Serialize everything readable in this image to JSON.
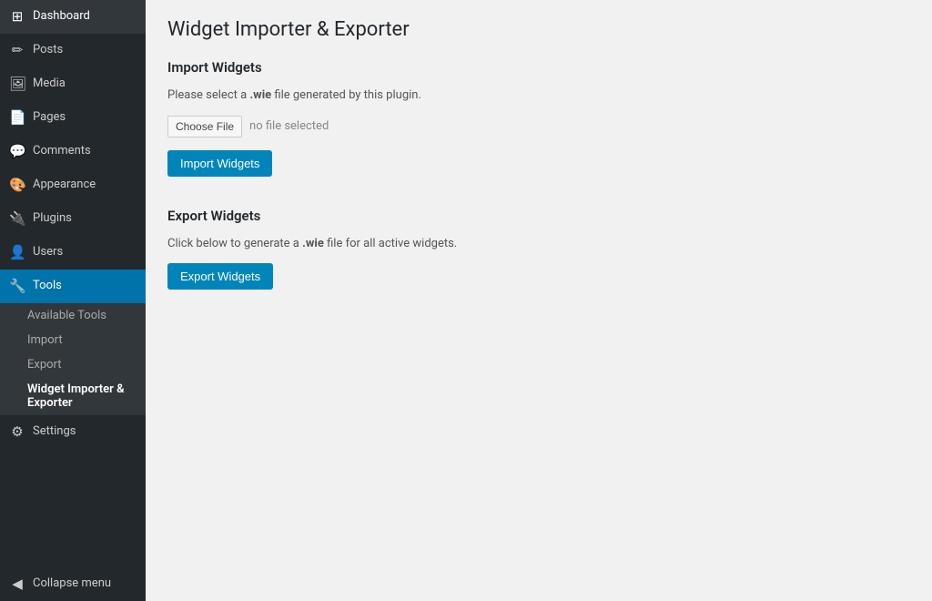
{
  "sidebar": {
    "items": [
      {
        "id": "dashboard",
        "label": "Dashboard",
        "icon": "⊞",
        "active": false
      },
      {
        "id": "posts",
        "label": "Posts",
        "icon": "📝",
        "active": false
      },
      {
        "id": "media",
        "label": "Media",
        "icon": "🖼",
        "active": false
      },
      {
        "id": "pages",
        "label": "Pages",
        "icon": "📄",
        "active": false
      },
      {
        "id": "comments",
        "label": "Comments",
        "icon": "💬",
        "active": false
      },
      {
        "id": "appearance",
        "label": "Appearance",
        "icon": "🎨",
        "active": false
      },
      {
        "id": "plugins",
        "label": "Plugins",
        "icon": "🔌",
        "active": false
      },
      {
        "id": "users",
        "label": "Users",
        "icon": "👤",
        "active": false
      },
      {
        "id": "tools",
        "label": "Tools",
        "icon": "🔧",
        "active": true
      },
      {
        "id": "settings",
        "label": "Settings",
        "icon": "⚙",
        "active": false
      }
    ],
    "tools_submenu": [
      {
        "id": "available-tools",
        "label": "Available Tools",
        "active": false
      },
      {
        "id": "import",
        "label": "Import",
        "active": false
      },
      {
        "id": "export",
        "label": "Export",
        "active": false
      },
      {
        "id": "widget-importer",
        "label": "Widget Importer & Exporter",
        "active": true
      }
    ],
    "collapse_label": "Collapse menu"
  },
  "main": {
    "page_title": "Widget Importer & Exporter",
    "import_section": {
      "title": "Import Widgets",
      "description_prefix": "Please select a ",
      "description_extension": ".wie",
      "description_suffix": " file generated by this plugin.",
      "choose_file_label": "Choose File",
      "no_file_label": "no file selected",
      "button_label": "Import Widgets"
    },
    "export_section": {
      "title": "Export Widgets",
      "description_prefix": "Click below to generate a ",
      "description_extension": ".wie",
      "description_suffix": " file for all active widgets.",
      "button_label": "Export Widgets"
    }
  }
}
